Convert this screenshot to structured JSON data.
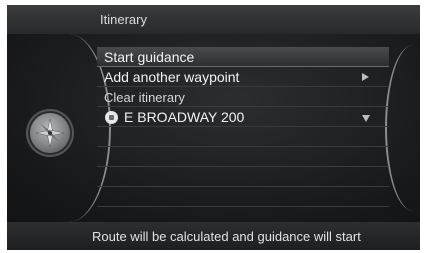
{
  "header": {
    "title": "Itinerary"
  },
  "menu": {
    "items": [
      {
        "label": "Start guidance",
        "highlighted": true
      },
      {
        "label": "Add another waypoint",
        "indicator": "arrow-right-icon"
      },
      {
        "label": "Clear itinerary"
      },
      {
        "label": "E BROADWAY 200",
        "icon": "waypoint-icon",
        "indicator": "arrow-down-icon"
      }
    ]
  },
  "knob": {
    "icon": "compass-icon"
  },
  "footer": {
    "status": "Route will be calculated and guidance will start"
  },
  "colors": {
    "background": "#0f1012",
    "text": "#f2f2f2",
    "frame": "#8b8c8e"
  }
}
